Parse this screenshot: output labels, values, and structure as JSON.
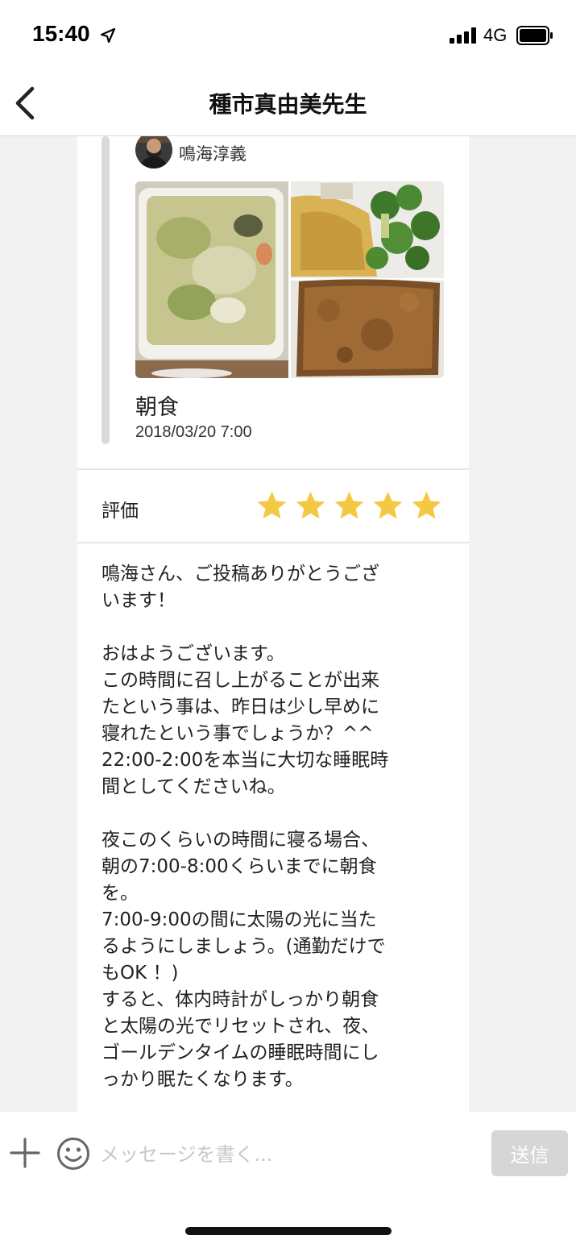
{
  "status_bar": {
    "time": "15:40",
    "network": "4G",
    "location_icon": "location-arrow-icon",
    "signal_icon": "cellular-signal-icon",
    "battery_icon": "battery-icon"
  },
  "nav": {
    "title": "種市真由美先生",
    "back_icon": "chevron-left-icon"
  },
  "post": {
    "poster_name": "鳴海淳義",
    "meal_name": "朝食",
    "datetime": "2018/03/20 7:00",
    "photos": [
      "soup-photo",
      "omelette-broccoli-photo",
      "toast-photo"
    ]
  },
  "rating": {
    "label": "評価",
    "stars": 5,
    "max_stars": 5,
    "star_color": "#f5c842"
  },
  "comment": {
    "text": "鳴海さん、ご投稿ありがとうござ\nいます！\n\nおはようございます。\nこの時間に召し上がることが出来\nたという事は、昨日は少し早めに\n寝れたという事でしょうか？^^\n22:00-2:00を本当に大切な睡眠時\n間としてくださいね。\n\n夜このくらいの時間に寝る場合、\n朝の7:00-8:00くらいまでに朝食\nを。\n7:00-9:00の間に太陽の光に当た\nるようにしましょう。(通勤だけで\nもOK ！)\nすると、体内時計がしっかり朝食\nと太陽の光でリセットされ、夜、\nゴールデンタイムの睡眠時間にし\nっかり眠たくなります。"
  },
  "input_bar": {
    "placeholder": "メッセージを書く...",
    "value": "",
    "send_label": "送信",
    "plus_icon": "plus-icon",
    "emoji_icon": "smiley-icon"
  }
}
